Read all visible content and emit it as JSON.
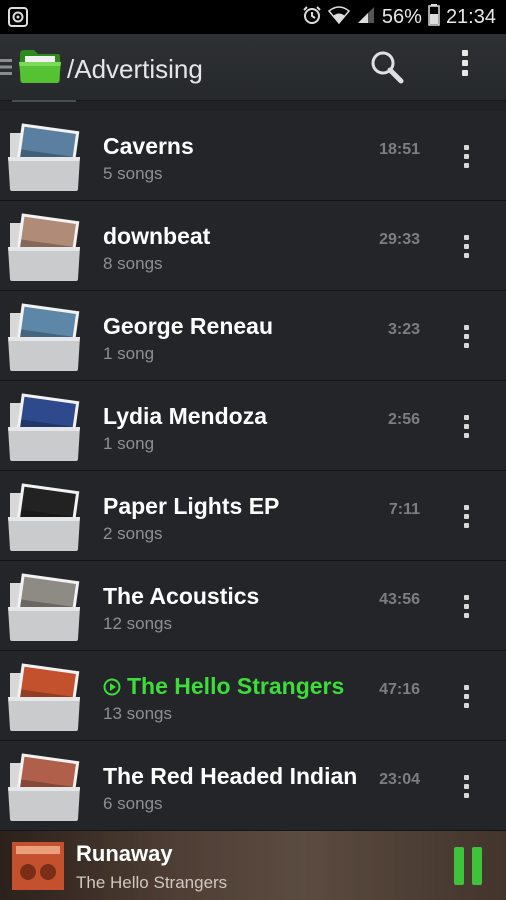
{
  "status": {
    "battery_percent": "56%",
    "time": "21:34"
  },
  "app_bar": {
    "path": "/Advertising"
  },
  "folders": [
    {
      "title": "Caverns",
      "subtitle": "5 songs",
      "duration": "18:51",
      "art_color": "#5a7fa0",
      "playing": false
    },
    {
      "title": "downbeat",
      "subtitle": "8 songs",
      "duration": "29:33",
      "art_color": "#b08c78",
      "playing": false
    },
    {
      "title": "George Reneau",
      "subtitle": "1 song",
      "duration": "3:23",
      "art_color": "#5d87a8",
      "playing": false
    },
    {
      "title": "Lydia Mendoza",
      "subtitle": "1 song",
      "duration": "2:56",
      "art_color": "#2e4a8c",
      "playing": false
    },
    {
      "title": "Paper Lights EP",
      "subtitle": "2 songs",
      "duration": "7:11",
      "art_color": "#222222",
      "playing": false
    },
    {
      "title": "The Acoustics",
      "subtitle": "12 songs",
      "duration": "43:56",
      "art_color": "#8e8a84",
      "playing": false
    },
    {
      "title": "The Hello Strangers",
      "subtitle": "13 songs",
      "duration": "47:16",
      "art_color": "#c4512e",
      "playing": true
    },
    {
      "title": "The Red Headed Indian",
      "subtitle": "6 songs",
      "duration": "23:04",
      "art_color": "#b0604a",
      "playing": false
    }
  ],
  "now_playing": {
    "title": "Runaway",
    "artist": "The Hello Strangers"
  },
  "colors": {
    "accent_green": "#3ddc3a",
    "folder_green": "#4cb830"
  }
}
